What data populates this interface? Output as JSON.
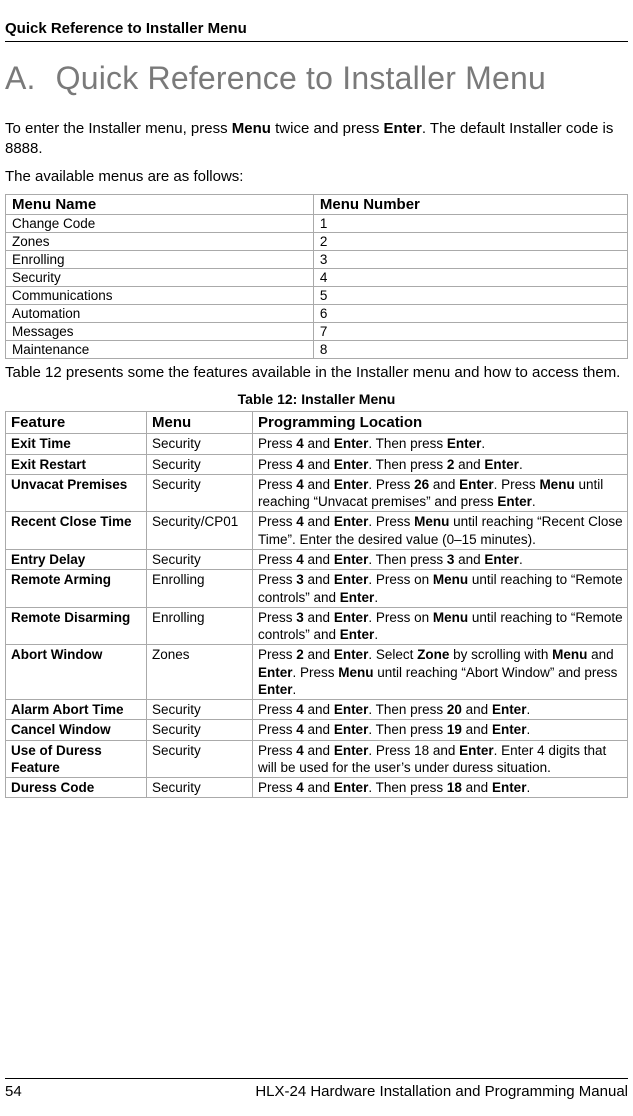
{
  "running_head": "Quick Reference to Installer Menu",
  "title": {
    "num": "A.",
    "text": "Quick Reference to Installer Menu"
  },
  "intro": {
    "p1_a": "To enter the Installer menu, press ",
    "p1_b": " twice and press ",
    "p1_c": ". The default Installer code is 8888.",
    "menu_key": "Menu",
    "enter_key": "Enter",
    "p2": "The available menus are as follows:"
  },
  "table1": {
    "headers": [
      "Menu Name",
      "Menu Number"
    ],
    "rows": [
      [
        "Change Code",
        "1"
      ],
      [
        "Zones",
        "2"
      ],
      [
        "Enrolling",
        "3"
      ],
      [
        "Security",
        "4"
      ],
      [
        "Communications",
        "5"
      ],
      [
        "Automation",
        "6"
      ],
      [
        "Messages",
        "7"
      ],
      [
        "Maintenance",
        "8"
      ]
    ]
  },
  "between": "Table 12 presents some the features available in the Installer menu and how to access them.",
  "caption": "Table 12: Installer Menu",
  "table2": {
    "headers": [
      "Feature",
      "Menu",
      "Programming Location"
    ],
    "rows": [
      {
        "feature": "Exit Time",
        "menu": "Security",
        "loc": "Press <b>4</b> and <b>Enter</b>. Then press <b>Enter</b>."
      },
      {
        "feature": "Exit Restart",
        "menu": "Security",
        "loc": "Press <b>4</b> and <b>Enter</b>. Then press <b>2</b> and <b>Enter</b>."
      },
      {
        "feature": "Unvacat Premises",
        "menu": "Security",
        "loc": "Press <b>4</b> and <b>Enter</b>. Press <b>26</b> and <b>Enter</b>. Press <b>Menu</b> until reaching “Unvacat premises” and press <b>Enter</b>."
      },
      {
        "feature": "Recent Close Time",
        "menu": "Security/CP01",
        "loc": "Press <b>4</b> and <b>Enter</b>. Press <b>Menu</b> until reaching “Recent Close Time”. Enter the desired value (0–15 minutes)."
      },
      {
        "feature": "Entry Delay",
        "menu": "Security",
        "loc": "Press <b>4</b> and <b>Enter</b>. Then press <b>3</b> and <b>Enter</b>."
      },
      {
        "feature": "Remote Arming",
        "menu": "Enrolling",
        "loc": "Press <b>3</b> and <b>Enter</b>. Press on <b>Menu</b> until reaching to “Remote controls” and <b>Enter</b>."
      },
      {
        "feature": "Remote Disarming",
        "menu": "Enrolling",
        "loc": "Press <b>3</b> and <b>Enter</b>. Press on <b>Menu</b> until reaching to “Remote controls” and <b>Enter</b>."
      },
      {
        "feature": "Abort Window",
        "menu": "Zones",
        "loc": "Press <b>2</b> and <b>Enter</b>. Select <b>Zone</b> by scrolling with <b>Menu</b> and <b>Enter</b>. Press <b>Menu</b> until reaching “Abort Window” and press <b>Enter</b>."
      },
      {
        "feature": "Alarm Abort Time",
        "menu": "Security",
        "loc": "Press <b>4</b> and <b>Enter</b>. Then press <b>20</b> and <b>Enter</b>."
      },
      {
        "feature": "Cancel Window",
        "menu": "Security",
        "loc": "Press <b>4</b> and <b>Enter</b>. Then press <b>19</b> and <b>Enter</b>."
      },
      {
        "feature": "Use of Duress Feature",
        "menu": "Security",
        "loc": "Press <b>4</b> and <b>Enter</b>. Press 18 and <b>Enter</b>. Enter 4 digits that will be used for the user’s under duress situation."
      },
      {
        "feature": "Duress Code",
        "menu": "Security",
        "loc": "Press <b>4</b> and <b>Enter</b>. Then press <b>18</b> and <b>Enter</b>."
      }
    ]
  },
  "footer": {
    "page": "54",
    "doc": "HLX-24 Hardware Installation and Programming Manual"
  }
}
